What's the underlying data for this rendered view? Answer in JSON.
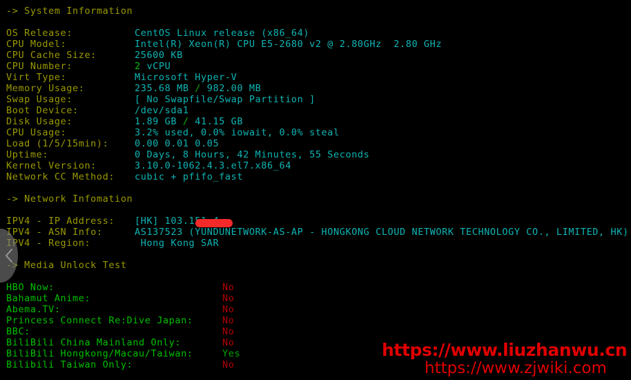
{
  "terminal": {
    "background": "#000000",
    "header_color": "#9a9a00",
    "label_color": "#9a9a00",
    "value_color": "#0fb5b5",
    "accent_green": "#00c000",
    "fail_red": "#b40000",
    "watermark_color": "#e00000"
  },
  "sections": {
    "system": {
      "header": "-> System Information",
      "rows": [
        {
          "label": "OS Release:",
          "value": "CentOS Linux release (x86_64)"
        },
        {
          "label": "CPU Model:",
          "value": "Intel(R) Xeon(R) CPU E5-2680 v2 @ 2.80GHz  2.80 GHz"
        },
        {
          "label": "CPU Cache Size:",
          "value": "25600 KB"
        },
        {
          "label": "CPU Number:",
          "value_pre": "2",
          "value_post": " vCPU"
        },
        {
          "label": "Virt Type:",
          "value": "Microsoft Hyper-V"
        },
        {
          "label": "Memory Usage:",
          "value_pre": "235.68 MB ",
          "sep": "/",
          "value_post": " 982.00 MB"
        },
        {
          "label": "Swap Usage:",
          "value": "[ No Swapfile/Swap Partition ]"
        },
        {
          "label": "Boot Device:",
          "value": "/dev/sda1"
        },
        {
          "label": "Disk Usage:",
          "value_pre": "1.89 GB ",
          "sep": "/",
          "value_post": " 41.15 GB"
        },
        {
          "label": "CPU Usage:",
          "value": "3.2% used, 0.0% iowait, 0.0% steal"
        },
        {
          "label": "Load (1/5/15min):",
          "value": "0.00 0.01 0.05"
        },
        {
          "label": "Uptime:",
          "value": "0 Days, 8 Hours, 42 Minutes, 55 Seconds"
        },
        {
          "label": "Kernel Version:",
          "value": "3.10.0-1062.4.3.el7.x86_64"
        },
        {
          "label": "Network CC Method:",
          "value": "cubic + pfifo_fast"
        }
      ]
    },
    "network": {
      "header": "-> Network Infomation",
      "rows": [
        {
          "label": "IPV4 - IP Address:",
          "value": "[HK] 103.151.4",
          "redacted": true
        },
        {
          "label": "IPV4 - ASN Info:",
          "value": "AS137523 (YUNDUNETWORK-AS-AP - HONGKONG CLOUD NETWORK TECHNOLOGY CO., LIMITED, HK)"
        },
        {
          "label": "IPV4 - Region:",
          "value": " Hong Kong SAR"
        }
      ]
    },
    "media": {
      "header": "-> Media Unlock Test",
      "rows": [
        {
          "label": "HBO Now:",
          "value": "No"
        },
        {
          "label": "Bahamut Anime:",
          "value": "No"
        },
        {
          "label": "Abema.TV:",
          "value": "No"
        },
        {
          "label": "Princess Connect Re:Dive Japan:",
          "value": "No"
        },
        {
          "label": "BBC:",
          "value": "No"
        },
        {
          "label": "BiliBili China Mainland Only:",
          "value": "No"
        },
        {
          "label": "BiliBili Hongkong/Macau/Taiwan:",
          "value": "Yes"
        },
        {
          "label": "Bilibili Taiwan Only:",
          "value": "No"
        }
      ]
    }
  },
  "overlay": {
    "back_button_icon": "chevron-left-icon"
  },
  "watermarks": {
    "primary": "https://www.liuzhanwu.cn",
    "secondary": "https://www.zjwiki.com"
  }
}
